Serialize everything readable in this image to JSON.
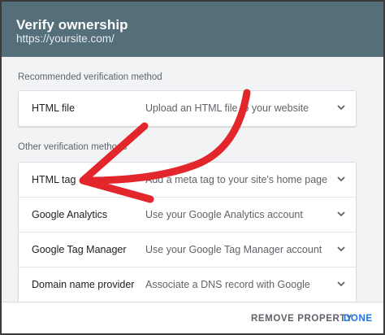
{
  "dialog": {
    "title": "Verify ownership",
    "subtitle": "https://yoursite.com/"
  },
  "recommended": {
    "label": "Recommended verification method",
    "methods": [
      {
        "name": "HTML file",
        "description": "Upload an HTML file to your website",
        "icon": "chevron-down-icon"
      }
    ]
  },
  "other": {
    "label": "Other verification methods",
    "methods": [
      {
        "name": "HTML tag",
        "description": "Add a meta tag to your site's home page",
        "icon": "chevron-down-icon"
      },
      {
        "name": "Google Analytics",
        "description": "Use your Google Analytics account",
        "icon": "chevron-down-icon"
      },
      {
        "name": "Google Tag Manager",
        "description": "Use your Google Tag Manager account",
        "icon": "chevron-down-icon"
      },
      {
        "name": "Domain name provider",
        "description": "Associate a DNS record with Google",
        "icon": "chevron-down-icon"
      }
    ]
  },
  "footer": {
    "remove_label": "REMOVE PROPERTY",
    "done_label": "DONE"
  },
  "colors": {
    "header_bg": "#546e7a",
    "accent": "#1a73e8",
    "annotation_arrow": "#e3262b"
  }
}
